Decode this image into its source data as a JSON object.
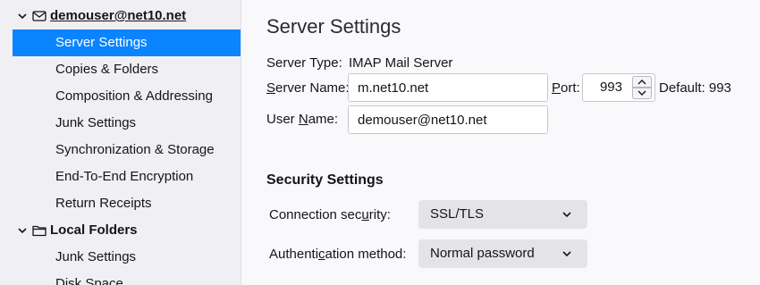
{
  "sidebar": {
    "account": {
      "name": "demouser@net10.net",
      "icon": "envelope-icon",
      "items": [
        {
          "label": "Server Settings",
          "selected": true
        },
        {
          "label": "Copies & Folders"
        },
        {
          "label": "Composition & Addressing"
        },
        {
          "label": "Junk Settings"
        },
        {
          "label": "Synchronization & Storage"
        },
        {
          "label": "End-To-End Encryption"
        },
        {
          "label": "Return Receipts"
        }
      ]
    },
    "local_folders": {
      "name": "Local Folders",
      "icon": "folder-icon",
      "items": [
        {
          "label": "Junk Settings"
        },
        {
          "label": "Disk Space"
        }
      ]
    }
  },
  "main": {
    "title": "Server Settings",
    "server_type": {
      "label": "Server Type:",
      "value": "IMAP Mail Server"
    },
    "server_name": {
      "label_pre": "",
      "label_accel": "S",
      "label_post": "erver Name:",
      "value": "m.net10.net"
    },
    "port": {
      "label_accel": "P",
      "label_post": "ort:",
      "value": "993",
      "default_text": "Default: 993"
    },
    "user_name": {
      "label_pre": "User ",
      "label_accel": "N",
      "label_post": "ame:",
      "value": "demouser@net10.net"
    },
    "security": {
      "title": "Security Settings",
      "connection": {
        "label_pre": "Connection sec",
        "label_accel": "u",
        "label_post": "rity:",
        "value": "SSL/TLS"
      },
      "authentication": {
        "label_pre": "Authenti",
        "label_accel": "c",
        "label_post": "ation method:",
        "value": "Normal password"
      }
    }
  },
  "colors": {
    "selection": "#0a84ff",
    "sidebar_bg": "#f0f0f4",
    "page_bg": "#f9f9fb"
  }
}
